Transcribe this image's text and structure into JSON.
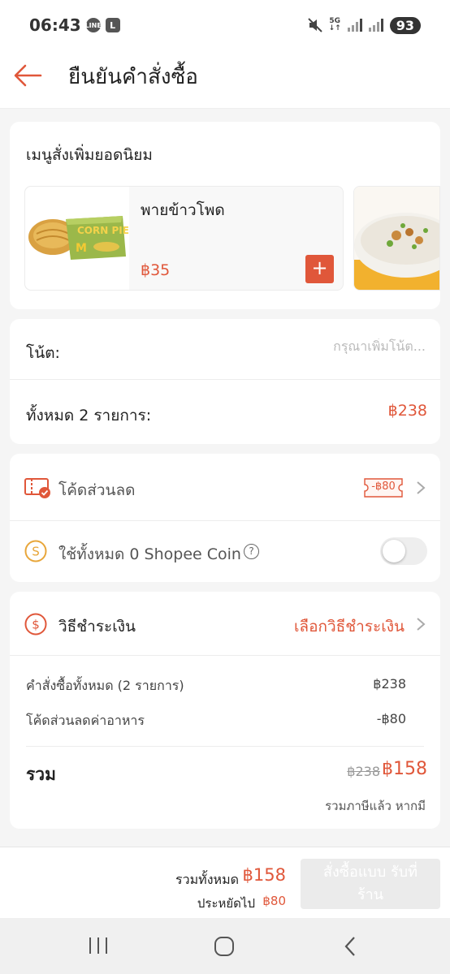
{
  "status_bar": {
    "time": "06:43",
    "network": "5G",
    "battery": "93",
    "badges": [
      "LINE",
      "L"
    ]
  },
  "header": {
    "title": "ยืนยันคำสั่งซื้อ"
  },
  "popular_menu": {
    "title": "เมนูสั่งเพิ่มยอดนิยม",
    "items": [
      {
        "name": "พายข้าวโพด",
        "price": "฿35",
        "image_label": "CORN PIE",
        "add_label": "+"
      }
    ]
  },
  "note": {
    "label": "โน้ต:",
    "placeholder": "กรุณาเพิ่มโน้ต..."
  },
  "total_items": {
    "label": "ทั้งหมด 2 รายการ:",
    "value": "฿238"
  },
  "discount": {
    "label": "โค้ดส่วนลด",
    "voucher_value": "-฿80"
  },
  "coins": {
    "label": "ใช้ทั้งหมด 0 Shopee Coin",
    "help": "?",
    "enabled": false
  },
  "payment": {
    "label": "วิธีชำระเงิน",
    "action": "เลือกวิธีชำระเงิน",
    "summary": [
      {
        "label": "คำสั่งซื้อทั้งหมด (2 รายการ)",
        "value": "฿238"
      },
      {
        "label": "โค้ดส่วนลดค่าอาหาร",
        "value": "-฿80"
      }
    ],
    "total_label": "รวม",
    "original_total": "฿238",
    "total": "฿158",
    "tax_note": "รวมภาษีแล้ว หากมี"
  },
  "bottom": {
    "total_label": "รวมทั้งหมด",
    "total_value": "฿158",
    "saved_label": "ประหยัดไป",
    "saved_value": "฿80",
    "order_button_line1": "สั่งซื้อแบบ รับที่",
    "order_button_line2": "ร้าน"
  },
  "colors": {
    "accent": "#e0573a",
    "coin": "#e8a63a",
    "background": "#f5f5f5"
  }
}
